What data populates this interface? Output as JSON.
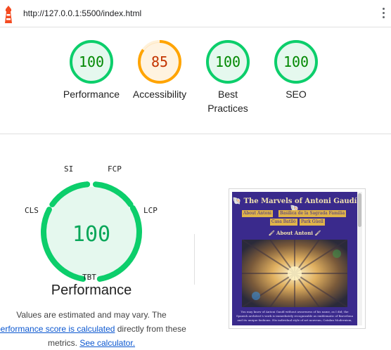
{
  "browser": {
    "url": "http://127.0.0.1:5500/index.html",
    "logo_icon": "lighthouse-icon",
    "menu_icon": "kebab-menu-icon"
  },
  "categories": [
    {
      "label": "Performance",
      "score": "100",
      "color": "#0cce6b"
    },
    {
      "label": "Accessibility",
      "score": "85",
      "color": "#ffa400"
    },
    {
      "label": "Best Practices",
      "score": "100",
      "color": "#0cce6b"
    },
    {
      "label": "SEO",
      "score": "100",
      "color": "#0cce6b"
    }
  ],
  "performance": {
    "score": "100",
    "title": "Performance",
    "metrics": [
      "SI",
      "FCP",
      "LCP",
      "TBT",
      "CLS"
    ],
    "color": "#0cce6b"
  },
  "note": {
    "line1": "Values are estimated and may vary. The",
    "link1": "performance score is calculated",
    "line2_rest": " directly from these",
    "line3": "metrics. ",
    "link2": "See calculator."
  },
  "screenshot": {
    "title": "🐚 The Marvels of Antoni Gaudí 🐚",
    "nav": [
      "About Antoni",
      "Basilica de la Sagrada Familia",
      "Casa Batlló",
      "Park Güell"
    ],
    "subtitle": "🖌 About Antoni 🖌",
    "body": "You may know of Antoni Gaudí without awareness of his name, as I did; the Spanish architect's work is immediately recognizable as emblematic of Barcelona and its unique fashions. His individual style of art nouveau, Catalan Modernism,"
  }
}
